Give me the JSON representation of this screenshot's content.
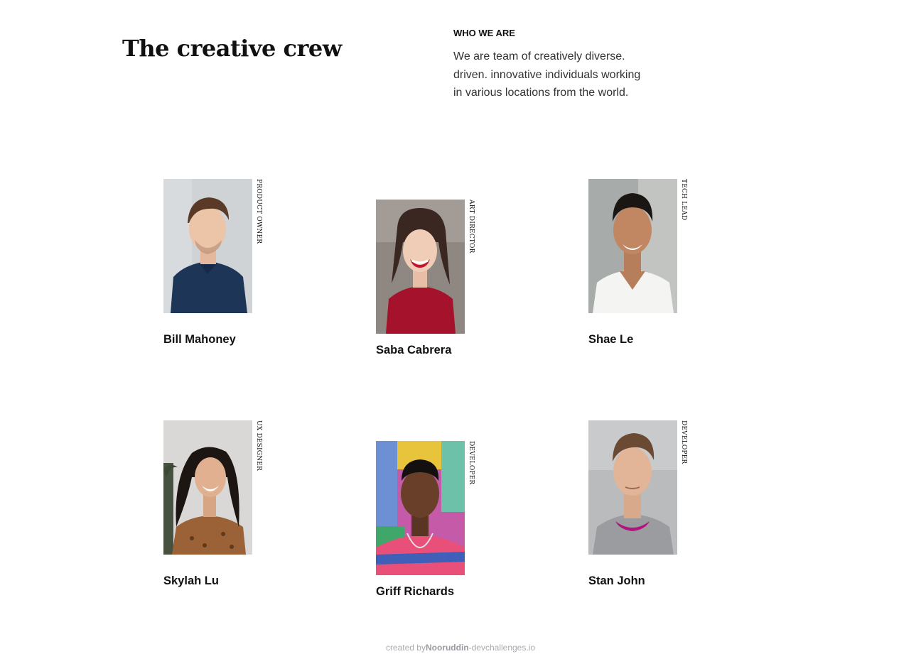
{
  "header": {
    "title": "The creative crew",
    "eyebrow": "WHO WE ARE",
    "intro_lines": [
      "We are team of creatively diverse.",
      "driven. innovative individuals working",
      "in various locations from the world."
    ]
  },
  "members": [
    {
      "name": "Bill Mahoney",
      "role": "PRODUCT OWNER"
    },
    {
      "name": "Saba Cabrera",
      "role": "ART DIRECTOR"
    },
    {
      "name": "Shae Le",
      "role": "TECH LEAD"
    },
    {
      "name": "Skylah Lu",
      "role": "UX DESIGNER"
    },
    {
      "name": "Griff Richards",
      "role": "DEVELOPER"
    },
    {
      "name": "Stan John",
      "role": "DEVELOPER"
    }
  ],
  "footer": {
    "prefix": "created by",
    "author": "Nooruddin",
    "suffix": "-devchallenges.io"
  },
  "colors": {
    "text": "#111111",
    "body_text": "#333333",
    "footer_text": "#a9a9b0"
  }
}
